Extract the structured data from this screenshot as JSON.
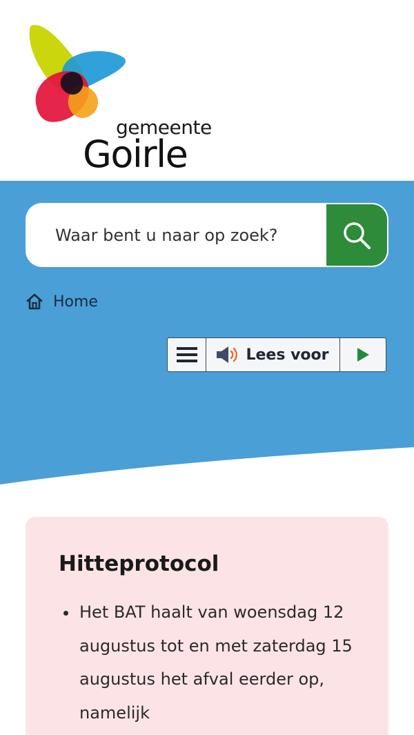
{
  "logo": {
    "small_text": "gemeente",
    "big_text": "Goirle"
  },
  "colors": {
    "band_blue": "#4a9fd6",
    "search_green": "#2e8b3a",
    "alert_bg": "#fce4e6"
  },
  "search": {
    "placeholder": "Waar bent u naar op zoek?",
    "button_icon": "search-icon"
  },
  "breadcrumb": {
    "icon": "home-icon",
    "label": "Home"
  },
  "readspeaker": {
    "menu_icon": "hamburger-menu-icon",
    "speaker_icon": "speaker-icon",
    "label": "Lees voor",
    "play_icon": "play-icon"
  },
  "alert": {
    "title": "Hitteprotocol",
    "items": [
      "Het BAT haalt van woensdag 12 augustus tot en met zaterdag 15 augustus het afval eerder op, namelijk"
    ]
  }
}
